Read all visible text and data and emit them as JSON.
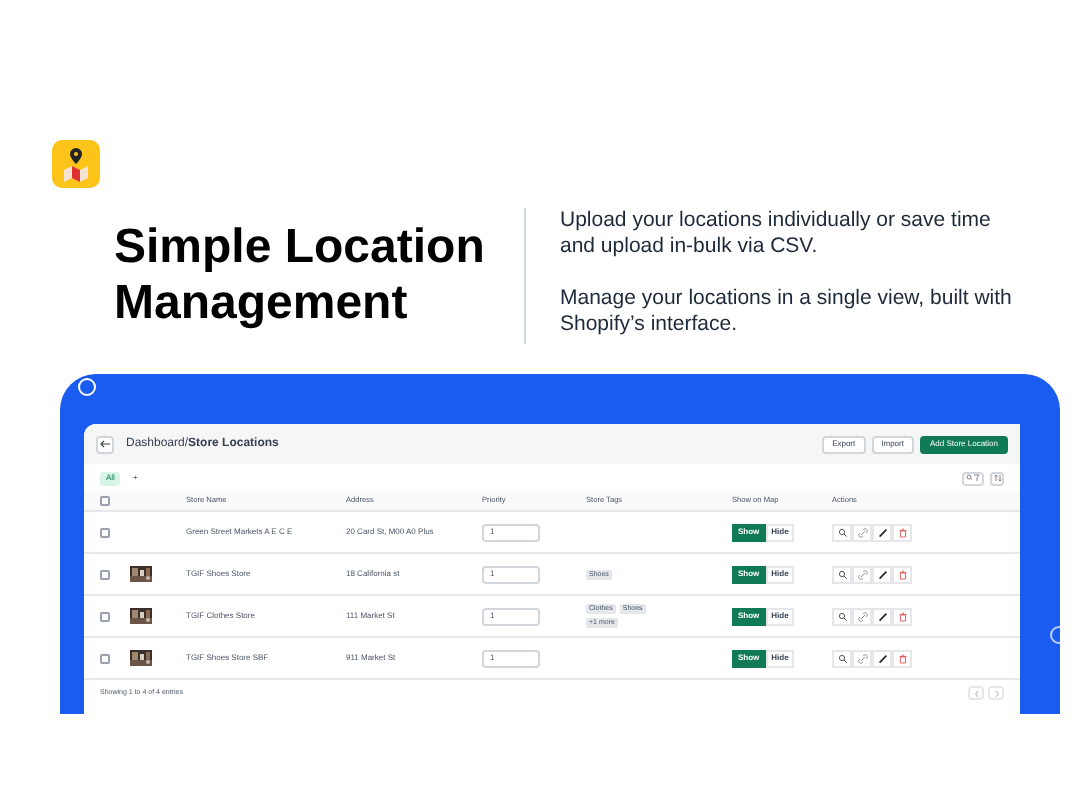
{
  "hero": {
    "title": "Simple Location Management",
    "paragraphs": [
      "Upload your locations individually or save time and upload in-bulk via CSV.",
      "Manage your locations in a single view, built with Shopify’s interface."
    ]
  },
  "app": {
    "breadcrumb": "Dashboard/**Store Locations**",
    "buttons": [
      {
        "label": "Export",
        "kind": "secondary"
      },
      {
        "label": "Import",
        "kind": "secondary"
      },
      {
        "label": "Add Store Location",
        "kind": "primary"
      }
    ],
    "filters": [
      {
        "label": "All",
        "selected": true
      },
      {
        "label": "+",
        "selected": false
      }
    ],
    "select_all_checked": false,
    "columns": [
      "Store Name",
      "Address",
      "Priority",
      "Store Tags",
      "Show on Map",
      "Actions"
    ],
    "rows": [
      {
        "checked": false,
        "thumbnail": false,
        "name": "Green Street Markets A E C E",
        "address": "20 Card St, M00 A0 Plus",
        "priority": "1",
        "tags": [],
        "toggle": [
          {
            "label": "Show",
            "selected": true
          },
          {
            "label": "Hide",
            "selected": false
          }
        ]
      },
      {
        "checked": false,
        "thumbnail": true,
        "name": "TGIF Shoes Store",
        "address": "18 California st",
        "priority": "1",
        "tags": [
          "Shoes"
        ],
        "toggle": [
          {
            "label": "Show",
            "selected": true
          },
          {
            "label": "Hide",
            "selected": false
          }
        ]
      },
      {
        "checked": false,
        "thumbnail": true,
        "name": "TGIF Clothes Store",
        "address": "111 Market St",
        "priority": "1",
        "tags": [
          "Clothes",
          "Shoes",
          "+1 more"
        ],
        "toggle": [
          {
            "label": "Show",
            "selected": true
          },
          {
            "label": "Hide",
            "selected": false
          }
        ]
      },
      {
        "checked": false,
        "thumbnail": true,
        "name": "TGIF Shoes Store SBF",
        "address": "911 Market St",
        "priority": "1",
        "tags": [],
        "toggle": [
          {
            "label": "Show",
            "selected": true
          },
          {
            "label": "Hide",
            "selected": false
          }
        ]
      }
    ],
    "footer": "Showing 1 to 4 of 4 entries"
  }
}
